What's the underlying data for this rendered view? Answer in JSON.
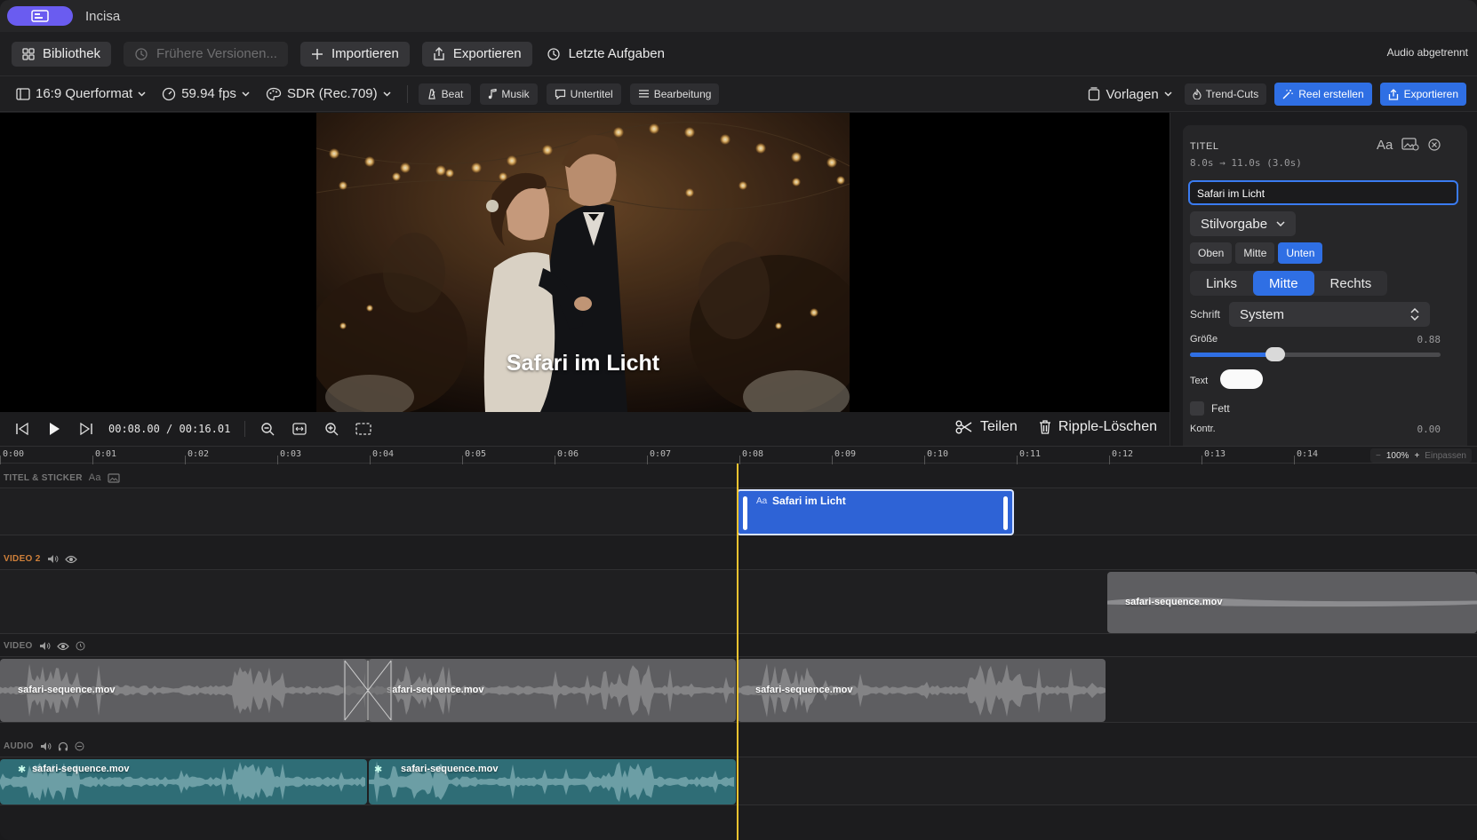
{
  "app": {
    "name": "Incisa"
  },
  "toolbar": {
    "library": "Bibliothek",
    "versions": "Frühere Versionen...",
    "import": "Importieren",
    "export": "Exportieren",
    "recent": "Letzte Aufgaben",
    "audio_status": "Audio abgetrennt"
  },
  "format_bar": {
    "aspect": "16:9 Querformat",
    "fps": "59.94 fps",
    "color": "SDR (Rec.709)",
    "chips": [
      "Beat",
      "Musik",
      "Untertitel",
      "Bearbeitung"
    ],
    "templates": "Vorlagen",
    "trend_cuts": "Trend-Cuts",
    "reel": "Reel erstellen",
    "export": "Exportieren"
  },
  "viewer": {
    "overlay_title": "Safari im Licht"
  },
  "transport": {
    "current": "00:08.00",
    "sep": "/",
    "total": "00:16.01",
    "split": "Teilen",
    "ripple_delete": "Ripple-Löschen"
  },
  "inspector": {
    "header": "TITEL",
    "range": "8.0s → 11.0s  (3.0s)",
    "title_value": "Safari im Licht",
    "style_preset": "Stilvorgabe",
    "vertical": [
      "Oben",
      "Mitte",
      "Unten"
    ],
    "vertical_active": "Unten",
    "horizontal": [
      "Links",
      "Mitte",
      "Rechts"
    ],
    "horizontal_active": "Mitte",
    "font_label": "Schrift",
    "font_value": "System",
    "size_label": "Größe",
    "size_value": "0.88",
    "size_fraction": 0.34,
    "text_label": "Text",
    "text_color": "#fafafa",
    "bold_label": "Fett",
    "contrast_label": "Kontr.",
    "contrast_value": "0.00"
  },
  "timeline": {
    "ruler_labels": [
      "0:00",
      "0:01",
      "0:02",
      "0:03",
      "0:04",
      "0:05",
      "0:06",
      "0:07",
      "0:08",
      "0:09",
      "0:10",
      "0:11",
      "0:12",
      "0:13",
      "0:14"
    ],
    "zoom": {
      "minus": "−",
      "value": "100%",
      "plus": "+",
      "fit": "Einpassen"
    },
    "tracks": {
      "titles": {
        "label": "TITEL & STICKER"
      },
      "video2": {
        "label": "VIDEO 2"
      },
      "video": {
        "label": "VIDEO"
      },
      "audio": {
        "label": "AUDIO"
      }
    },
    "title_clip": {
      "badge": "Aa",
      "name": "Safari im Licht"
    },
    "video2_clip": "safari-sequence.mov",
    "video_clips": [
      "safari-sequence.mov",
      "safari-sequence.mov",
      "safari-sequence.mov"
    ],
    "audio_clips": [
      "safari-sequence.mov",
      "safari-sequence.mov"
    ]
  },
  "colors": {
    "accent": "#2f6fe4",
    "playhead": "#f0c330",
    "video2_label": "#d0803a",
    "audio_clip": "#2f6d76"
  }
}
